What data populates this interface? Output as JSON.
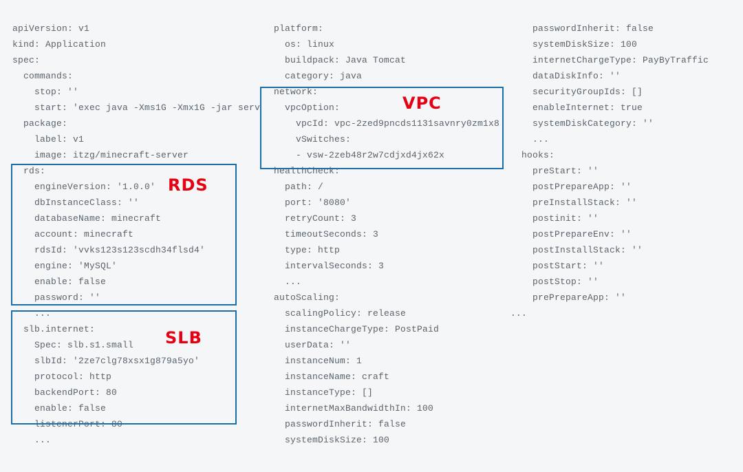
{
  "columns": {
    "col1": "apiVersion: v1\nkind: Application\nspec:\n  commands:\n    stop: ''\n    start: 'exec java -Xms1G -Xmx1G -jar serv\n  package:\n    label: v1\n    image: itzg/minecraft-server\n  rds:\n    engineVersion: '1.0.0'\n    dbInstanceClass: ''\n    databaseName: minecraft\n    account: minecraft\n    rdsId: 'vvks123s123scdh34flsd4'\n    engine: 'MySQL'\n    enable: false\n    password: ''\n    ...\n  slb.internet:\n    Spec: slb.s1.small\n    slbId: '2ze7clg78xsx1g879a5yo'\n    protocol: http\n    backendPort: 80\n    enable: false\n    listenerPort: 80\n    ...",
    "col2": "  platform:\n    os: linux\n    buildpack: Java Tomcat\n    category: java\n  network:\n    vpcOption:\n      vpcId: vpc-2zed9pncds1131savnry0zm1x8\n      vSwitches:\n      - vsw-2zeb48r2w7cdjxd4jx62x\n  healthCheck:\n    path: /\n    port: '8080'\n    retryCount: 3\n    timeoutSeconds: 3\n    type: http\n    intervalSeconds: 3\n    ...\n  autoScaling:\n    scalingPolicy: release\n    instanceChargeType: PostPaid\n    userData: ''\n    instanceNum: 1\n    instanceName: craft\n    instanceType: []\n    internetMaxBandwidthIn: 100\n    passwordInherit: false\n    systemDiskSize: 100",
    "col3": "    passwordInherit: false\n    systemDiskSize: 100\n    internetChargeType: PayByTraffic\n    dataDiskInfo: ''\n    securityGroupIds: []\n    enableInternet: true\n    systemDiskCategory: ''\n    ...\n  hooks:\n    preStart: ''\n    postPrepareApp: ''\n    preInstallStack: ''\n    postinit: ''\n    postPrepareEnv: ''\n    postInstallStack: ''\n    postStart: ''\n    postStop: ''\n    prePrepareApp: ''\n..."
  },
  "labels": {
    "rds": "RDS",
    "slb": "SLB",
    "vpc": "VPC"
  }
}
